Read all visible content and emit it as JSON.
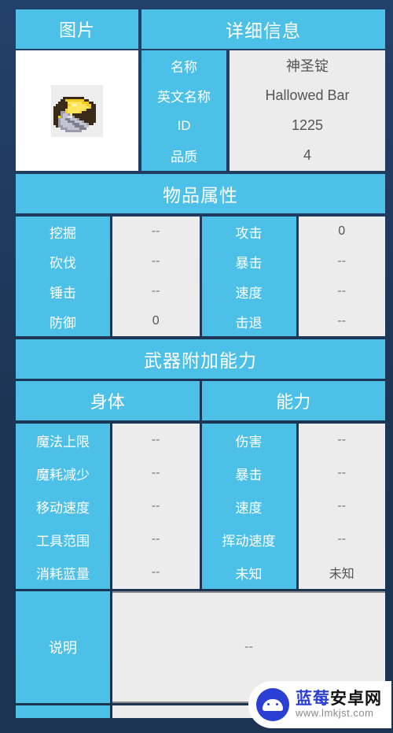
{
  "picture": {
    "header": "图片",
    "sprite_alt": "hallowed-bar-sprite"
  },
  "detail": {
    "header": "详细信息",
    "rows": [
      {
        "label": "名称",
        "value": "神圣锭"
      },
      {
        "label": "英文名称",
        "value": "Hallowed Bar"
      },
      {
        "label": "ID",
        "value": "1225"
      },
      {
        "label": "品质",
        "value": "4"
      }
    ]
  },
  "item_attributes": {
    "header": "物品属性",
    "left": [
      {
        "label": "挖掘",
        "value": "--"
      },
      {
        "label": "砍伐",
        "value": "--"
      },
      {
        "label": "锤击",
        "value": "--"
      },
      {
        "label": "防御",
        "value": "0"
      }
    ],
    "right": [
      {
        "label": "攻击",
        "value": "0"
      },
      {
        "label": "暴击",
        "value": "--"
      },
      {
        "label": "速度",
        "value": "--"
      },
      {
        "label": "击退",
        "value": "--"
      }
    ]
  },
  "weapon_bonus": {
    "header": "武器附加能力",
    "group_left_header": "身体",
    "group_right_header": "能力",
    "left": [
      {
        "label": "魔法上限",
        "value": "--"
      },
      {
        "label": "魔耗减少",
        "value": "--"
      },
      {
        "label": "移动速度",
        "value": "--"
      },
      {
        "label": "工具范围",
        "value": "--"
      },
      {
        "label": "消耗蓝量",
        "value": "--"
      }
    ],
    "right": [
      {
        "label": "伤害",
        "value": "--"
      },
      {
        "label": "暴击",
        "value": "--"
      },
      {
        "label": "速度",
        "value": "--"
      },
      {
        "label": "挥动速度",
        "value": "--"
      },
      {
        "label": "未知",
        "value": "未知"
      }
    ]
  },
  "description": {
    "label": "说明",
    "value": "--"
  },
  "watermark": {
    "title_blue": "蓝莓",
    "title_black": "安卓网",
    "url": "www.lmkjst.com"
  },
  "colors": {
    "accent": "#4dc0e8",
    "page_background": "#1d3555",
    "value_background": "#ececec",
    "text_on_accent": "#ffffff",
    "value_text": "#555555"
  }
}
